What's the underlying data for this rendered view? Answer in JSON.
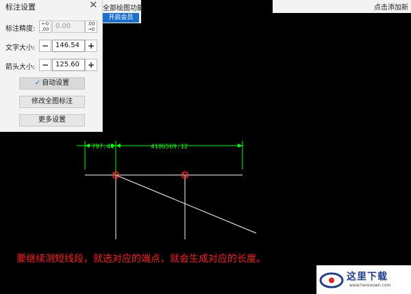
{
  "panel": {
    "title": "标注设置",
    "precision_label": "标注精度:",
    "precision_value": "0.00",
    "precision_dec_label": "←0\n.00",
    "precision_inc_label": ".00\n→0",
    "text_size_label": "文字大小:",
    "text_size_value": "146.54",
    "arrow_size_label": "箭头大小:",
    "arrow_size_value": "125.60",
    "minus": "−",
    "plus": "+",
    "auto_setting": "自动设置",
    "modify_all": "修改全图标注",
    "more_settings": "更多设置",
    "close": "✕"
  },
  "behind_popup": {
    "text": "全部绘图功能",
    "vip_button": "开启会员"
  },
  "top_right": {
    "text": "点击添加新"
  },
  "canvas": {
    "dim_left": "797.44",
    "dim_right": "4186569.12",
    "line_color": "#ffffff",
    "dim_color": "#00ff00",
    "marker_color": "#ff2020"
  },
  "caption": "要继续测短线段，就选对应的端点，就会生成对应的长度。",
  "watermark": {
    "text": "这里下载",
    "url": "www.hereoown.com"
  }
}
